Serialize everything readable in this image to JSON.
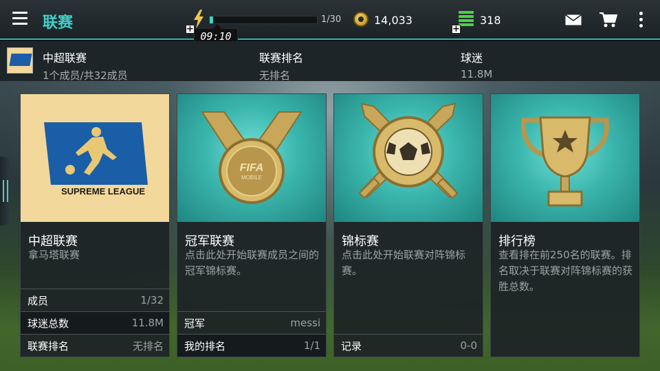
{
  "header": {
    "title": "联赛",
    "energy": {
      "current": 1,
      "max": 30,
      "label": "1/30",
      "timer": "09:10"
    },
    "coins": "14,033",
    "cash": "318"
  },
  "infobar": {
    "league_name": "中超联赛",
    "members_summary": "1个成员/共32成员",
    "rank_label": "联赛排名",
    "rank_value": "无排名",
    "fans_label": "球迷",
    "fans_value": "11.8M"
  },
  "cards": [
    {
      "title": "中超联赛",
      "subtitle": "拿马塔联赛",
      "logo_text": "SUPREME LEAGUE",
      "stats": [
        {
          "label": "成员",
          "value": "1/32"
        },
        {
          "label": "球迷总数",
          "value": "11.8M"
        },
        {
          "label": "联赛排名",
          "value": "无排名"
        }
      ]
    },
    {
      "title": "冠军联赛",
      "subtitle": "点击此处开始联赛成员之间的冠军锦标赛。",
      "medal_text_1": "FIFA",
      "medal_text_2": "MOBILE",
      "stats": [
        {
          "label": "冠军",
          "value": "messi"
        },
        {
          "label": "我的排名",
          "value": "1/1"
        }
      ]
    },
    {
      "title": "锦标赛",
      "subtitle": "点击此处开始联赛对阵锦标赛。",
      "stats": [
        {
          "label": "记录",
          "value": "0-0"
        }
      ]
    },
    {
      "title": "排行榜",
      "subtitle": "查看排在前250名的联赛。排名取决于联赛对阵锦标赛的获胜总数。",
      "stats": []
    }
  ],
  "colors": {
    "accent": "#3fd0c8",
    "gold": "#f2d89a",
    "teal": "#3bb6ad"
  }
}
